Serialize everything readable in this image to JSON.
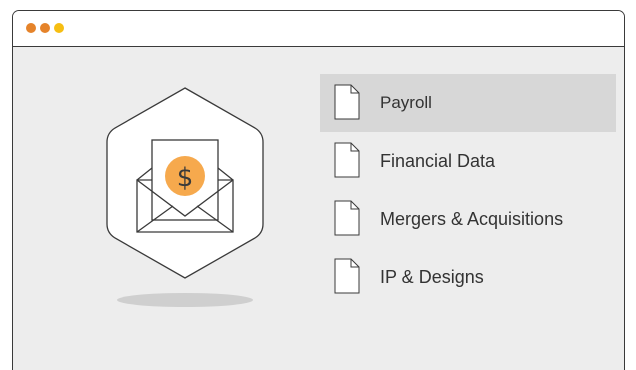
{
  "window": {
    "controls": [
      {
        "name": "close",
        "color": "#e5832a"
      },
      {
        "name": "minimize",
        "color": "#e5832a"
      },
      {
        "name": "maximize",
        "color": "#f6be12"
      }
    ]
  },
  "illustration": {
    "icon": "envelope-dollar-icon",
    "symbol": "$",
    "accent": "#f6a94d"
  },
  "files": {
    "selected_index": 0,
    "items": [
      {
        "label": "Payroll",
        "icon": "document-icon"
      },
      {
        "label": "Financial Data",
        "icon": "document-icon"
      },
      {
        "label": "Mergers & Acquisitions",
        "icon": "document-icon"
      },
      {
        "label": "IP & Designs",
        "icon": "document-icon"
      }
    ]
  }
}
